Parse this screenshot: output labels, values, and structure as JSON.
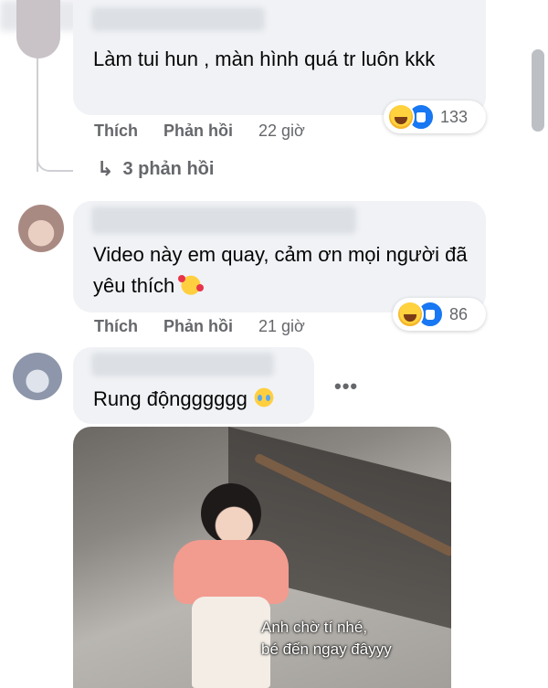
{
  "comments": [
    {
      "text": "Làm tui hun , màn hình quá tr luôn kkk",
      "actions": {
        "like": "Thích",
        "reply": "Phản hồi",
        "time": "22 giờ"
      },
      "reaction_count": "133",
      "replies_link": "3 phản hồi"
    },
    {
      "text": "Video này em quay, cảm ơn mọi người đã yêu thích",
      "actions": {
        "like": "Thích",
        "reply": "Phản hồi",
        "time": "21 giờ"
      },
      "reaction_count": "86"
    },
    {
      "text": "Rung độngggggg",
      "more": "•••",
      "gif_caption": "Anh chờ tí nhé,\nbé đến ngay đâyyy"
    }
  ],
  "colors": {
    "bubble": "#f0f2f5",
    "secondary_text": "#65676b",
    "like_blue": "#1877f2",
    "haha_yellow": "#ffd23e"
  }
}
